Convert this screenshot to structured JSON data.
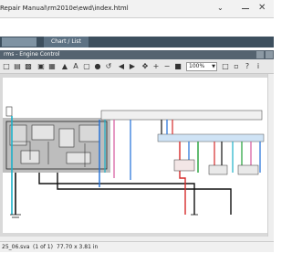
{
  "browser": {
    "url": "Repair Manual\\rm2010e\\ewd\\index.html"
  },
  "tabs": {
    "chart_list": "Chart / List"
  },
  "viewer": {
    "title": "rms - Engine Control",
    "zoom": "100%"
  },
  "status": {
    "file": "25_06.sva",
    "page": "(1 of 1)",
    "size": "77.70 x 3.81 in"
  },
  "colors": {
    "wire_blue": "#1e6fd8",
    "wire_red": "#d62a2a",
    "wire_green": "#1fa035",
    "wire_black": "#111111",
    "wire_pink": "#d6569c",
    "wire_cyan": "#1bb0c8"
  }
}
